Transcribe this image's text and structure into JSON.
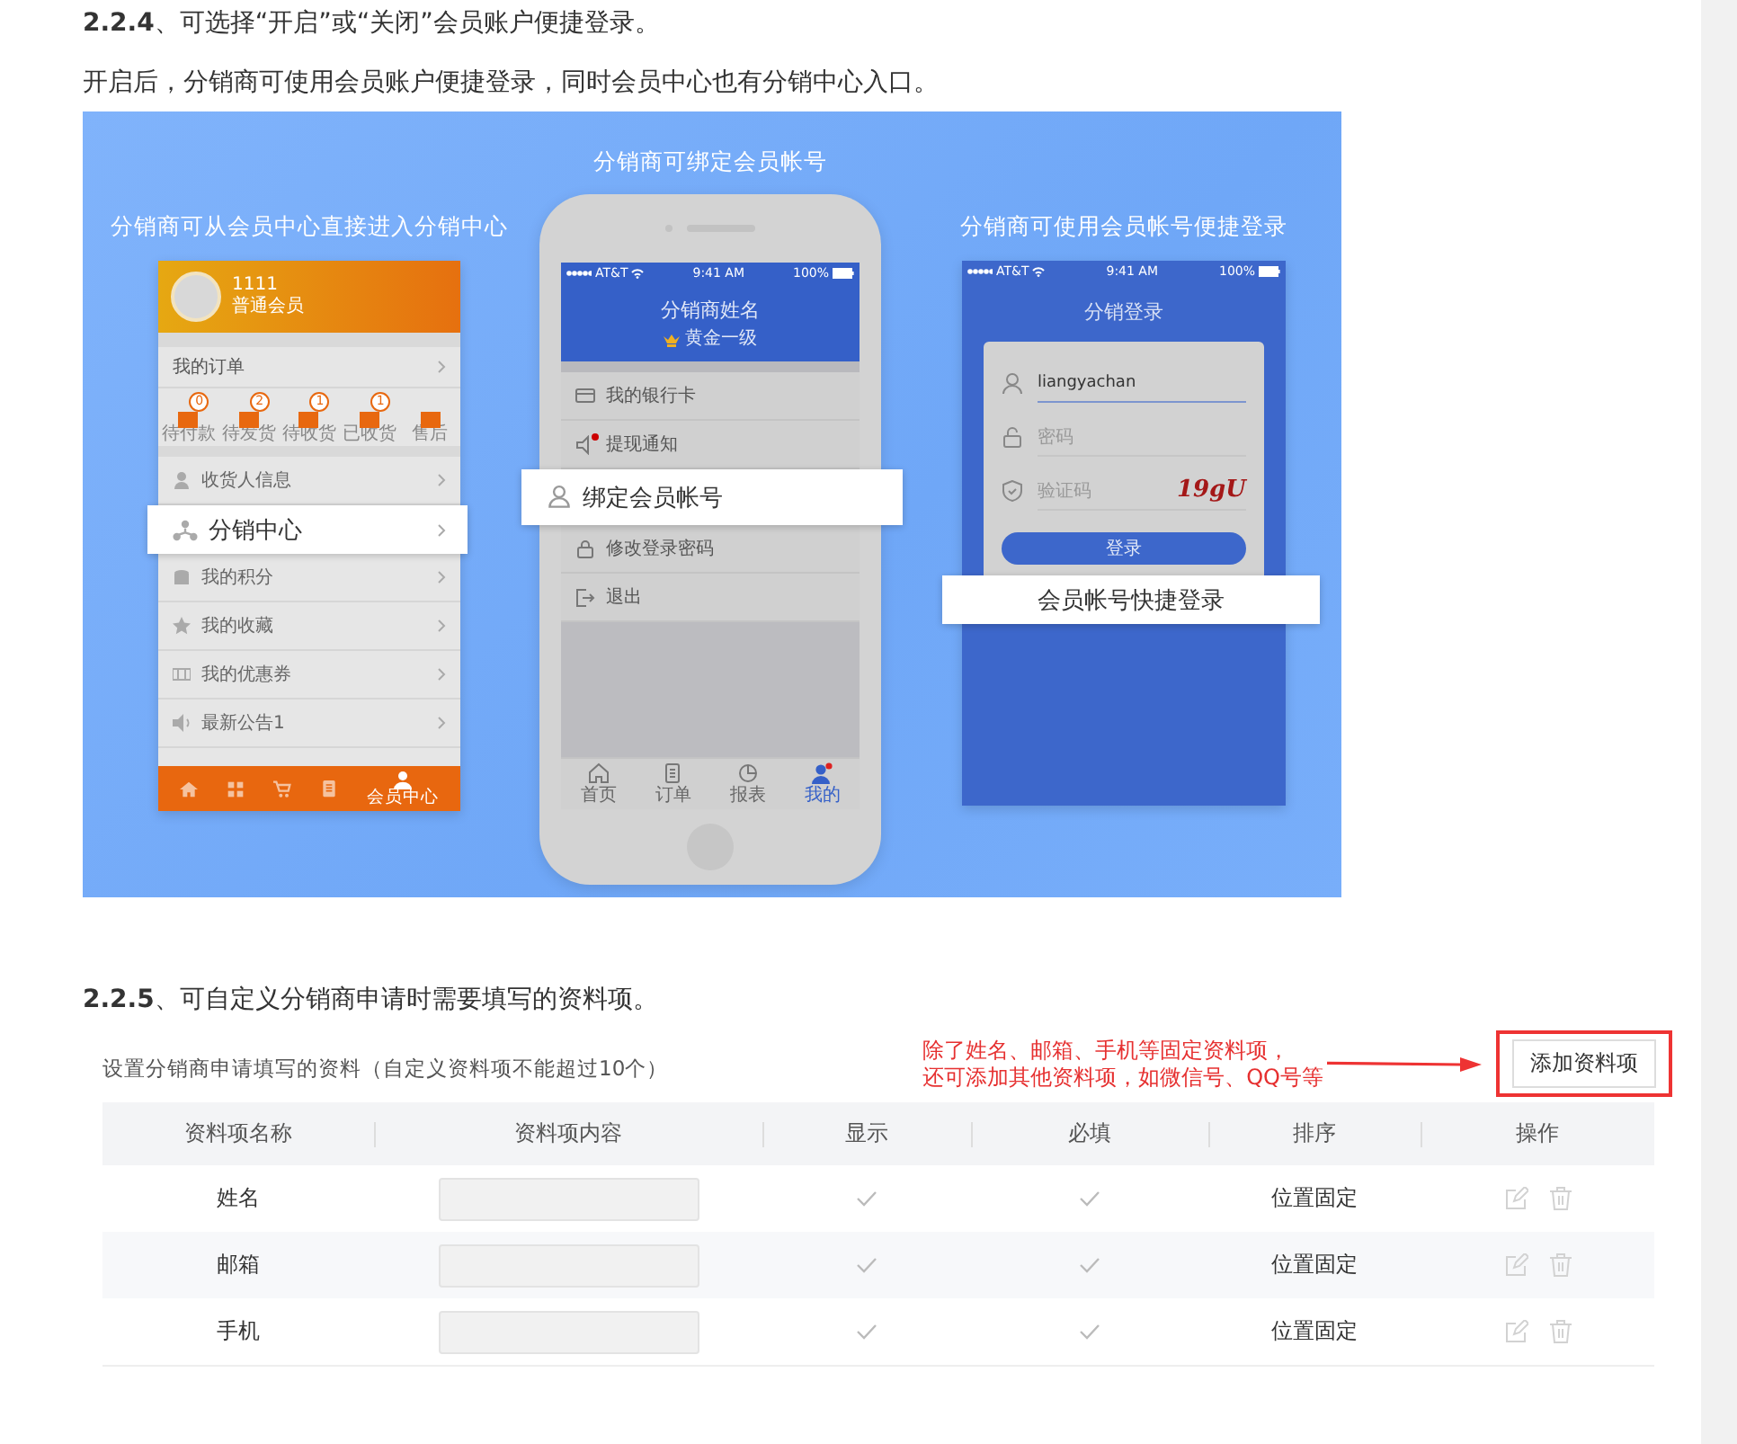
{
  "heading_224": "**2.2.4**、可选择“开启”或“关闭”会员账户便捷登录。",
  "intro": "开启后，分销商可使用会员账户便捷登录，同时会员中心也有分销中心入口。",
  "banner": {
    "panels": [
      {
        "kind": "member_center",
        "caption": "分销商可从会员中心直接进入分销中心",
        "user_name": "1111",
        "user_level": "普通会员",
        "orders_title": "我的订单",
        "order_items": [
          {
            "label": "待付款",
            "badge": "0"
          },
          {
            "label": "待发货",
            "badge": "2"
          },
          {
            "label": "待收货",
            "badge": "1"
          },
          {
            "label": "已收货",
            "badge": "1"
          },
          {
            "label": "售后"
          }
        ],
        "menu": [
          {
            "label": "收货人信息",
            "highlighted": false
          },
          {
            "label": "分销中心",
            "highlighted": true
          },
          {
            "label": "我的积分",
            "highlighted": false
          },
          {
            "label": "我的收藏",
            "highlighted": false
          },
          {
            "label": "我的优惠券",
            "highlighted": false
          },
          {
            "label": "最新公告1",
            "highlighted": false
          }
        ],
        "tabs": [
          {
            "selected": false
          },
          {
            "selected": false
          },
          {
            "selected": false
          },
          {
            "selected": false
          },
          {
            "label": "会员中心",
            "selected": true
          }
        ]
      },
      {
        "kind": "distributor_profile",
        "caption": "分销商可绑定会员帐号",
        "carrier": "AT&T",
        "time": "9:41 AM",
        "battery": "100%",
        "name": "分销商姓名",
        "level": "黄金一级",
        "menu": [
          {
            "label": "我的银行卡",
            "highlighted": false,
            "unread": false
          },
          {
            "label": "提现通知",
            "highlighted": false,
            "unread": true
          },
          {
            "label": "绑定会员帐号",
            "highlighted": true,
            "unread": false
          },
          {
            "label": "修改登录密码",
            "highlighted": false,
            "unread": false
          },
          {
            "label": "退出",
            "highlighted": false,
            "unread": false
          }
        ],
        "tabs": [
          {
            "label": "首页",
            "selected": false
          },
          {
            "label": "订单",
            "selected": false
          },
          {
            "label": "报表",
            "selected": false
          },
          {
            "label": "我的",
            "selected": true
          }
        ]
      },
      {
        "kind": "login",
        "caption": "分销商可使用会员帐号便捷登录",
        "carrier": "AT&T",
        "time": "9:41 AM",
        "battery": "100%",
        "title": "分销登录",
        "username": "liangyachan",
        "password_placeholder": "密码",
        "captcha_placeholder": "验证码",
        "captcha": "19gU",
        "submit": "登录",
        "callout": "会员帐号快捷登录"
      }
    ]
  },
  "heading_225": "**2.2.5**、可自定义分销商申请时需要填写的资料项。",
  "settings": {
    "caption": "设置分销商申请填写的资料（自定义资料项不能超过10个）",
    "note_lines": [
      "除了姓名、邮箱、手机等固定资料项，",
      "还可添加其他资料项，如微信号、QQ号等"
    ],
    "add_button": "添加资料项",
    "columns": [
      "资料项名称",
      "资料项内容",
      "显示",
      "必填",
      "排序",
      "操作"
    ],
    "rows": [
      {
        "name": "姓名",
        "shown": true,
        "required": true,
        "order": "位置固定",
        "disabled": true
      },
      {
        "name": "邮箱",
        "shown": true,
        "required": true,
        "order": "位置固定",
        "disabled": true
      },
      {
        "name": "手机",
        "shown": true,
        "required": true,
        "order": "位置固定",
        "disabled": true
      }
    ]
  }
}
